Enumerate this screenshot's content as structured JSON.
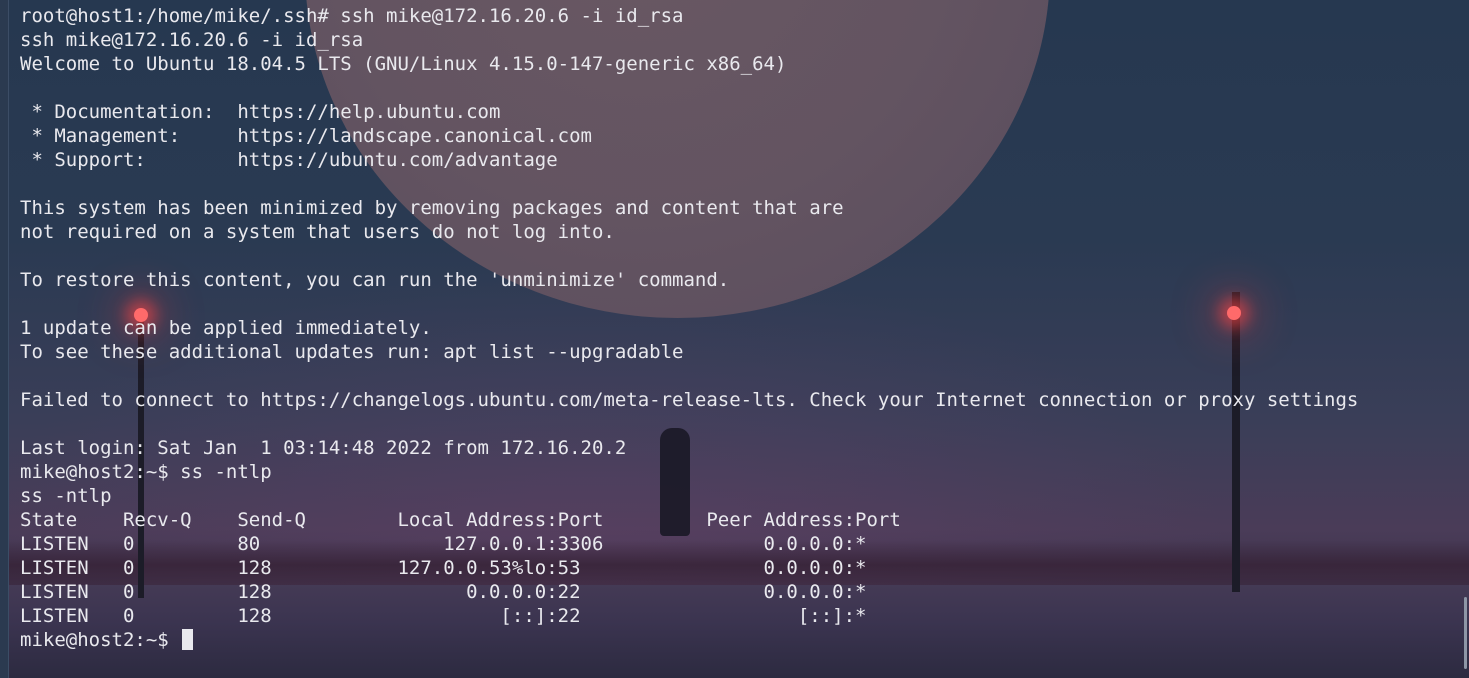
{
  "terminal": {
    "lines": [
      "root@host1:/home/mike/.ssh# ssh mike@172.16.20.6 -i id_rsa",
      "ssh mike@172.16.20.6 -i id_rsa",
      "Welcome to Ubuntu 18.04.5 LTS (GNU/Linux 4.15.0-147-generic x86_64)",
      "",
      " * Documentation:  https://help.ubuntu.com",
      " * Management:     https://landscape.canonical.com",
      " * Support:        https://ubuntu.com/advantage",
      "",
      "This system has been minimized by removing packages and content that are",
      "not required on a system that users do not log into.",
      "",
      "To restore this content, you can run the 'unminimize' command.",
      "",
      "1 update can be applied immediately.",
      "To see these additional updates run: apt list --upgradable",
      "",
      "Failed to connect to https://changelogs.ubuntu.com/meta-release-lts. Check your Internet connection or proxy settings",
      "",
      "Last login: Sat Jan  1 03:14:48 2022 from 172.16.20.2",
      "mike@host2:~$ ss -ntlp",
      "ss -ntlp",
      "State    Recv-Q    Send-Q        Local Address:Port         Peer Address:Port",
      "LISTEN   0         80                127.0.0.1:3306              0.0.0.0:*",
      "LISTEN   0         128           127.0.0.53%lo:53                0.0.0.0:*",
      "LISTEN   0         128                 0.0.0.0:22                0.0.0.0:*",
      "LISTEN   0         128                    [::]:22                   [::]:*"
    ],
    "prompt": "mike@host2:~$ "
  },
  "colors": {
    "text": "#e9e9ee",
    "lamp": "#ff6a6a"
  }
}
